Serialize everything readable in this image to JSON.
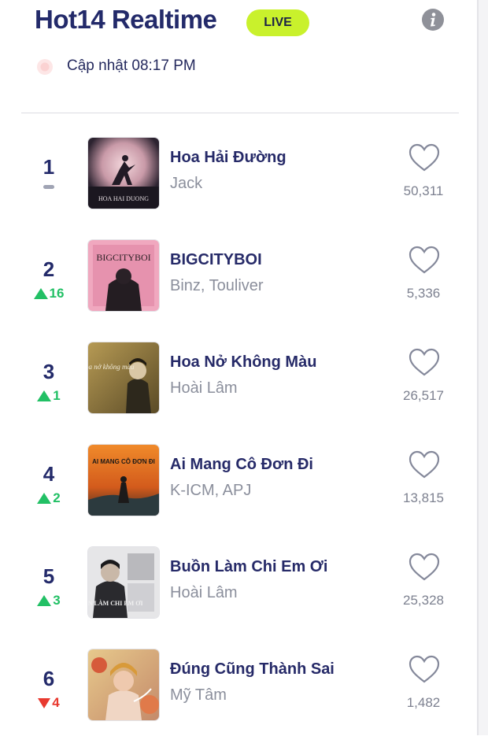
{
  "header": {
    "title": "Hot14 Realtime",
    "live_label": "LIVE",
    "update_text": "Cập nhật 08:17 PM"
  },
  "colors": {
    "title": "#232a6a",
    "live_badge": "#c9f12c",
    "up": "#22c065",
    "down": "#e8392f",
    "neutral": "#a0a4b4"
  },
  "songs": [
    {
      "rank": "1",
      "change": "",
      "change_dir": "same",
      "title": "Hoa Hải Đường",
      "artist": "Jack",
      "likes": "50,311",
      "cover_text": "HOA HAI DUONG"
    },
    {
      "rank": "2",
      "change": "16",
      "change_dir": "up",
      "title": "BIGCITYBOI",
      "artist": "Binz, Touliver",
      "likes": "5,336",
      "cover_text": "BIGCITYBOI"
    },
    {
      "rank": "3",
      "change": "1",
      "change_dir": "up",
      "title": "Hoa Nở Không Màu",
      "artist": "Hoài Lâm",
      "likes": "26,517",
      "cover_text": "Hoa nở không màu"
    },
    {
      "rank": "4",
      "change": "2",
      "change_dir": "up",
      "title": "Ai Mang Cô Đơn Đi",
      "artist": "K-ICM, APJ",
      "likes": "13,815",
      "cover_text": "AI MANG CÔ ĐƠN ĐI"
    },
    {
      "rank": "5",
      "change": "3",
      "change_dir": "up",
      "title": "Buồn Làm Chi Em Ơi",
      "artist": "Hoài Lâm",
      "likes": "25,328",
      "cover_text": "BUỒN LÀM CHI EM ƠI"
    },
    {
      "rank": "6",
      "change": "4",
      "change_dir": "down",
      "title": "Đúng Cũng Thành Sai",
      "artist": "Mỹ Tâm",
      "likes": "1,482",
      "cover_text": ""
    }
  ]
}
